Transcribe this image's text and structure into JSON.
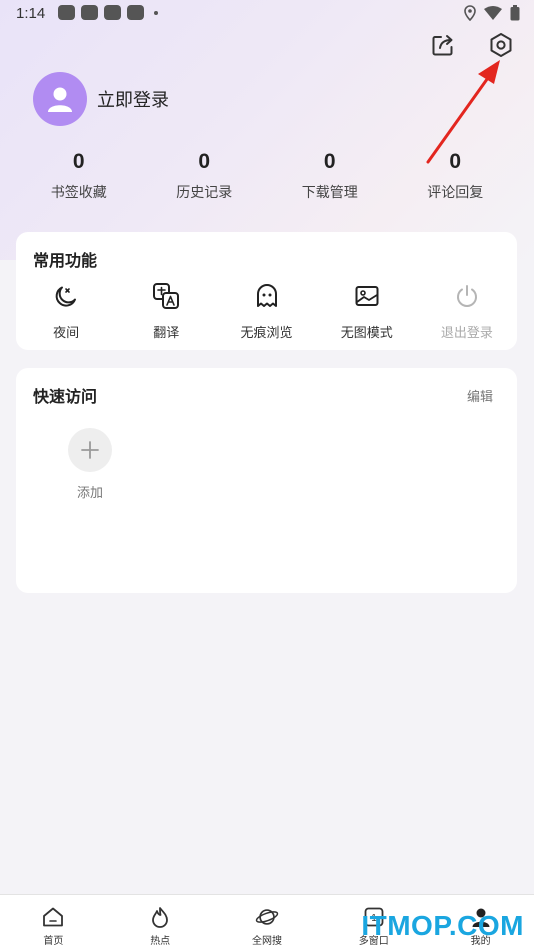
{
  "status_bar": {
    "time": "1:14"
  },
  "profile": {
    "login_label": "立即登录"
  },
  "stats": [
    {
      "value": "0",
      "label": "书签收藏"
    },
    {
      "value": "0",
      "label": "历史记录"
    },
    {
      "value": "0",
      "label": "下载管理"
    },
    {
      "value": "0",
      "label": "评论回复"
    }
  ],
  "common_functions": {
    "title": "常用功能",
    "items": [
      {
        "label": "夜间",
        "icon": "moon-icon"
      },
      {
        "label": "翻译",
        "icon": "translate-icon"
      },
      {
        "label": "无痕浏览",
        "icon": "ghost-icon"
      },
      {
        "label": "无图模式",
        "icon": "image-icon"
      },
      {
        "label": "退出登录",
        "icon": "power-icon",
        "disabled": true
      }
    ]
  },
  "quick_access": {
    "title": "快速访问",
    "edit_label": "编辑",
    "add_label": "添加"
  },
  "bottom_nav": [
    {
      "label": "首页",
      "icon": "home-icon"
    },
    {
      "label": "热点",
      "icon": "fire-icon"
    },
    {
      "label": "全网搜",
      "icon": "planet-icon"
    },
    {
      "label": "多窗口",
      "icon": "windows-icon",
      "badge": "1"
    },
    {
      "label": "我的",
      "icon": "person-icon"
    }
  ],
  "watermark": "ITMOP.COM",
  "colors": {
    "avatar": "#b18cf2",
    "arrow": "#e3261f",
    "watermark": "#1aa6e0"
  }
}
